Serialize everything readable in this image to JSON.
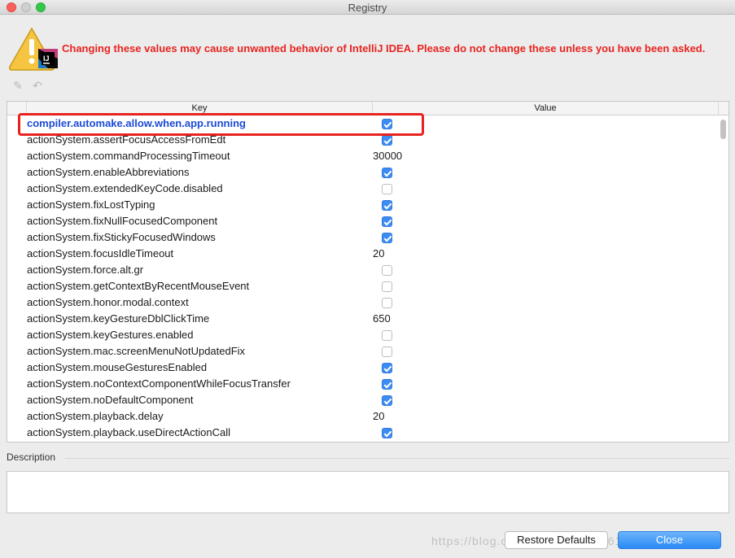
{
  "window": {
    "title": "Registry"
  },
  "warning": {
    "text": "Changing these values may cause unwanted behavior of IntelliJ IDEA. Please do not change these unless you have been asked."
  },
  "toolbar": {
    "edit_icon": "edit-icon",
    "undo_icon": "undo-icon"
  },
  "table": {
    "columns": {
      "key": "Key",
      "value": "Value"
    },
    "rows": [
      {
        "key": "compiler.automake.allow.when.app.running",
        "type": "bool",
        "value": true,
        "modified": true
      },
      {
        "key": "actionSystem.assertFocusAccessFromEdt",
        "type": "bool",
        "value": true
      },
      {
        "key": "actionSystem.commandProcessingTimeout",
        "type": "text",
        "value": "30000"
      },
      {
        "key": "actionSystem.enableAbbreviations",
        "type": "bool",
        "value": true
      },
      {
        "key": "actionSystem.extendedKeyCode.disabled",
        "type": "bool",
        "value": false
      },
      {
        "key": "actionSystem.fixLostTyping",
        "type": "bool",
        "value": true
      },
      {
        "key": "actionSystem.fixNullFocusedComponent",
        "type": "bool",
        "value": true
      },
      {
        "key": "actionSystem.fixStickyFocusedWindows",
        "type": "bool",
        "value": true
      },
      {
        "key": "actionSystem.focusIdleTimeout",
        "type": "text",
        "value": "20"
      },
      {
        "key": "actionSystem.force.alt.gr",
        "type": "bool",
        "value": false
      },
      {
        "key": "actionSystem.getContextByRecentMouseEvent",
        "type": "bool",
        "value": false
      },
      {
        "key": "actionSystem.honor.modal.context",
        "type": "bool",
        "value": false
      },
      {
        "key": "actionSystem.keyGestureDblClickTime",
        "type": "text",
        "value": "650"
      },
      {
        "key": "actionSystem.keyGestures.enabled",
        "type": "bool",
        "value": false
      },
      {
        "key": "actionSystem.mac.screenMenuNotUpdatedFix",
        "type": "bool",
        "value": false
      },
      {
        "key": "actionSystem.mouseGesturesEnabled",
        "type": "bool",
        "value": true
      },
      {
        "key": "actionSystem.noContextComponentWhileFocusTransfer",
        "type": "bool",
        "value": true
      },
      {
        "key": "actionSystem.noDefaultComponent",
        "type": "bool",
        "value": true
      },
      {
        "key": "actionSystem.playback.delay",
        "type": "text",
        "value": "20"
      },
      {
        "key": "actionSystem.playback.useDirectActionCall",
        "type": "bool",
        "value": true
      }
    ]
  },
  "description": {
    "label": "Description",
    "text": ""
  },
  "buttons": {
    "restore": "Restore Defaults",
    "close": "Close"
  },
  "watermark": "https://blog.csdn.net/baidu_33613619",
  "colors": {
    "warning": "#e8231f",
    "modified_key": "#1b4bd6",
    "checkbox": "#3d8cf3",
    "close_button": "#2a8af6"
  }
}
